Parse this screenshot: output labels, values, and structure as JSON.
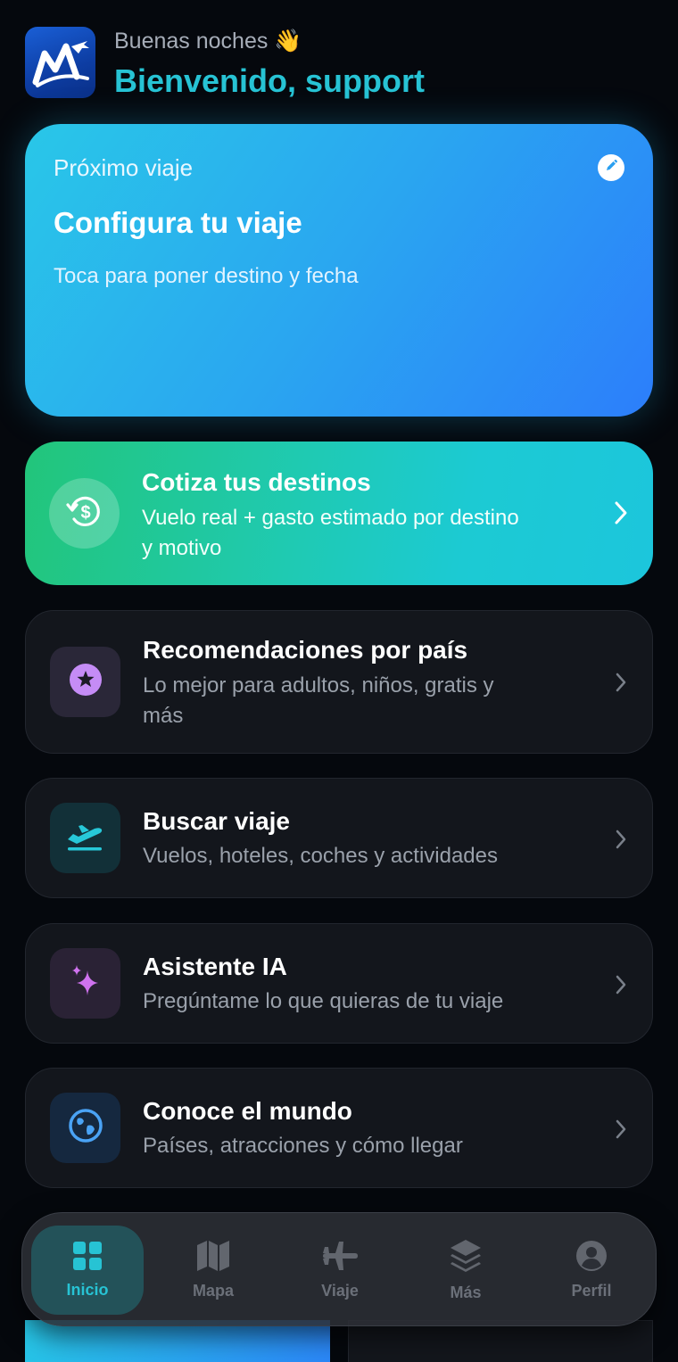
{
  "header": {
    "greeting": "Buenas noches 👋",
    "welcome": "Bienvenido, support"
  },
  "hero": {
    "label": "Próximo viaje",
    "title": "Configura tu viaje",
    "subtitle": "Toca para poner destino y fecha",
    "edit_icon": "pencil-icon"
  },
  "quote_card": {
    "title": "Cotiza tus destinos",
    "subtitle": "Vuelo real + gasto estimado por destino y motivo",
    "icon": "dollar-refresh-icon"
  },
  "cards": [
    {
      "title": "Recomendaciones por país",
      "subtitle": "Lo mejor para adultos, niños, gratis y más",
      "icon": "star-icon"
    },
    {
      "title": "Buscar viaje",
      "subtitle": "Vuelos, hoteles, coches y actividades",
      "icon": "plane-departure-icon"
    },
    {
      "title": "Asistente IA",
      "subtitle": "Pregúntame lo que quieras de tu viaje",
      "icon": "sparkles-icon"
    },
    {
      "title": "Conoce el mundo",
      "subtitle": "Países, atracciones y cómo llegar",
      "icon": "globe-icon"
    }
  ],
  "tabs": [
    {
      "label": "Inicio",
      "icon": "grid-icon",
      "active": true
    },
    {
      "label": "Mapa",
      "icon": "map-icon",
      "active": false
    },
    {
      "label": "Viaje",
      "icon": "airplane-icon",
      "active": false
    },
    {
      "label": "Más",
      "icon": "layers-icon",
      "active": false
    },
    {
      "label": "Perfil",
      "icon": "user-circle-icon",
      "active": false
    }
  ],
  "colors": {
    "accent": "#27c3d4",
    "background": "#05080d",
    "card": "#13161c"
  }
}
